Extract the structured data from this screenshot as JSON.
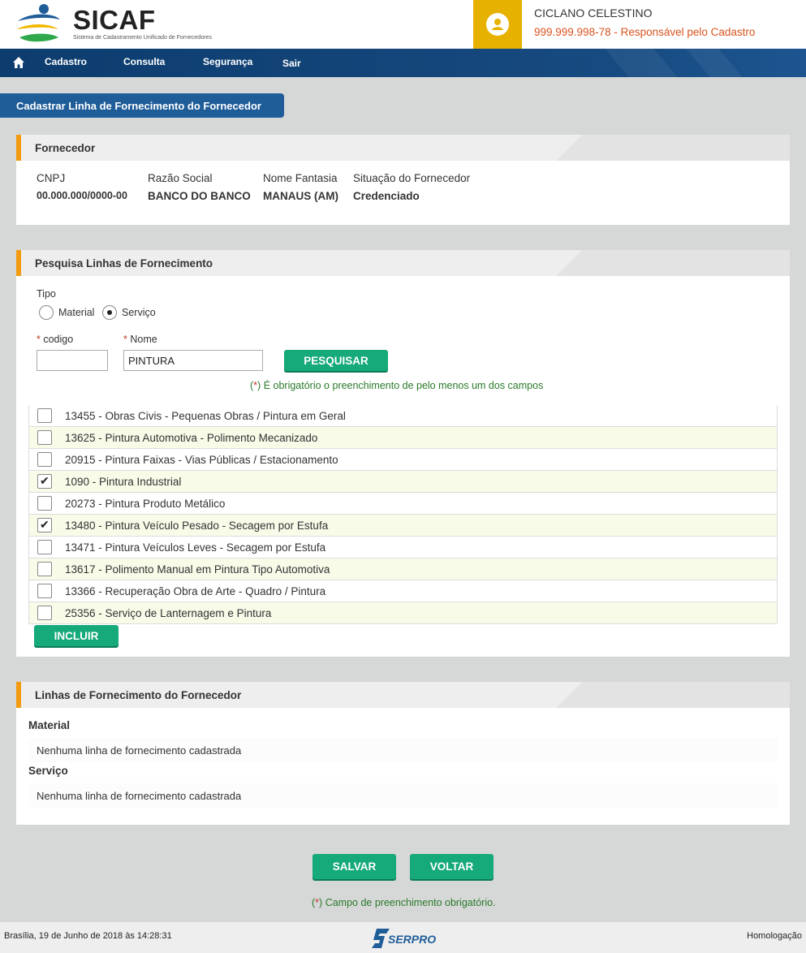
{
  "header": {
    "logo_title": "SICAF",
    "logo_subtitle": "Sistema de Cadastramento Unificado de Fornecedores",
    "user_name": "CICLANO CELESTINO",
    "user_role": "999.999.998-78 - Responsável pelo Cadastro"
  },
  "nav": {
    "items": [
      {
        "label": "Cadastro"
      },
      {
        "label": "Consulta"
      },
      {
        "label": "Segurança"
      },
      {
        "label": "Sair"
      }
    ]
  },
  "page_title": "Cadastrar Linha de Fornecimento do Fornecedor",
  "fornecedor": {
    "title": "Fornecedor",
    "fields": [
      {
        "label": "CNPJ",
        "value": "00.000.000/0000-00"
      },
      {
        "label": "Razão Social",
        "value": "BANCO DO BANCO"
      },
      {
        "label": "Nome Fantasia",
        "value": "MANAUS (AM)"
      },
      {
        "label": "Situação do Fornecedor",
        "value": "Credenciado"
      }
    ]
  },
  "pesquisa": {
    "title": "Pesquisa Linhas de Fornecimento",
    "tipo_label": "Tipo",
    "options": [
      {
        "label": "Material",
        "checked": false
      },
      {
        "label": "Serviço",
        "checked": true
      }
    ],
    "codigo_label": "codigo",
    "nome_label": "Nome",
    "codigo_value": "",
    "nome_value": "PINTURA",
    "required_mark": "*",
    "search_button": "PESQUISAR",
    "note": "É obrigatório o preenchimento de pelo menos um dos campos",
    "results": [
      {
        "label": "13455 - Obras Civis - Pequenas Obras / Pintura em Geral",
        "checked": false
      },
      {
        "label": "13625 - Pintura Automotiva - Polimento Mecanizado",
        "checked": false
      },
      {
        "label": "20915 - Pintura Faixas - Vias Públicas / Estacionamento",
        "checked": false
      },
      {
        "label": "1090 - Pintura Industrial",
        "checked": true
      },
      {
        "label": "20273 - Pintura Produto Metálico",
        "checked": false
      },
      {
        "label": "13480 - Pintura Veículo Pesado - Secagem por Estufa",
        "checked": true
      },
      {
        "label": "13471 - Pintura Veículos Leves - Secagem por Estufa",
        "checked": false
      },
      {
        "label": "13617 - Polimento Manual em Pintura Tipo Automotiva",
        "checked": false
      },
      {
        "label": "13366 - Recuperação Obra de Arte - Quadro / Pintura",
        "checked": false
      },
      {
        "label": "25356 - Serviço de Lanternagem e Pintura",
        "checked": false
      }
    ],
    "include_button": "INCLUIR"
  },
  "linhas": {
    "title": "Linhas de Fornecimento do Fornecedor",
    "material_label": "Material",
    "material_empty": "Nenhuma linha de fornecimento cadastrada",
    "servico_label": "Serviço",
    "servico_empty": "Nenhuma linha de fornecimento cadastrada"
  },
  "actions": {
    "save": "SALVAR",
    "back": "VOLTAR",
    "required_note": "Campo de preenchimento obrigatório."
  },
  "footer": {
    "date": "Brasília, 19 de Junho de 2018 às 14:28:31",
    "brand": "SERPRO",
    "env": "Homologação"
  },
  "colors": {
    "nav_blue": "#174a80",
    "accent_orange": "#f39c12",
    "button_green": "#16a97a",
    "user_yellow": "#e7b100"
  }
}
